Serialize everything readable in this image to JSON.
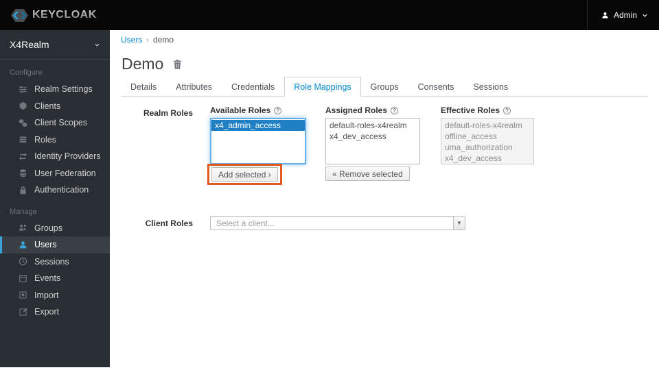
{
  "topbar": {
    "brand": "KEYCLOAK",
    "user": {
      "label": "Admin"
    }
  },
  "sidebar": {
    "realm_selector": {
      "label": "X4Realm"
    },
    "sections": [
      {
        "label": "Configure",
        "items": [
          {
            "label": "Realm Settings",
            "icon": "sliders-icon"
          },
          {
            "label": "Clients",
            "icon": "cube-icon"
          },
          {
            "label": "Client Scopes",
            "icon": "cubes-icon"
          },
          {
            "label": "Roles",
            "icon": "list-icon"
          },
          {
            "label": "Identity Providers",
            "icon": "exchange-icon"
          },
          {
            "label": "User Federation",
            "icon": "database-icon"
          },
          {
            "label": "Authentication",
            "icon": "lock-icon"
          }
        ]
      },
      {
        "label": "Manage",
        "items": [
          {
            "label": "Groups",
            "icon": "groups-icon"
          },
          {
            "label": "Users",
            "icon": "user-icon",
            "active": true
          },
          {
            "label": "Sessions",
            "icon": "clock-icon"
          },
          {
            "label": "Events",
            "icon": "calendar-icon"
          },
          {
            "label": "Import",
            "icon": "import-icon"
          },
          {
            "label": "Export",
            "icon": "export-icon"
          }
        ]
      }
    ]
  },
  "breadcrumb": {
    "link": "Users",
    "current": "demo"
  },
  "page": {
    "title": "Demo"
  },
  "tabs": {
    "items": [
      "Details",
      "Attributes",
      "Credentials",
      "Role Mappings",
      "Groups",
      "Consents",
      "Sessions"
    ],
    "active": "Role Mappings"
  },
  "role_mappings": {
    "realm_roles_label": "Realm Roles",
    "client_roles_label": "Client Roles",
    "available": {
      "header": "Available Roles",
      "roles": [
        {
          "name": "x4_admin_access",
          "selected": true
        }
      ],
      "action": {
        "label": "Add selected",
        "icon": "›"
      }
    },
    "assigned": {
      "header": "Assigned Roles",
      "roles": [
        {
          "name": "default-roles-x4realm"
        },
        {
          "name": "x4_dev_access"
        }
      ],
      "action": {
        "label": "Remove selected",
        "icon": "«"
      }
    },
    "effective": {
      "header": "Effective Roles",
      "roles": [
        {
          "name": "default-roles-x4realm"
        },
        {
          "name": "offline_access"
        },
        {
          "name": "uma_authorization"
        },
        {
          "name": "x4_dev_access"
        }
      ]
    },
    "client_select": {
      "placeholder": "Select a client..."
    }
  },
  "colors": {
    "accent": "#0088ce",
    "sidebar_active": "#39a5dc",
    "annotation": "#e25b1e",
    "selection": "#2180c4"
  }
}
